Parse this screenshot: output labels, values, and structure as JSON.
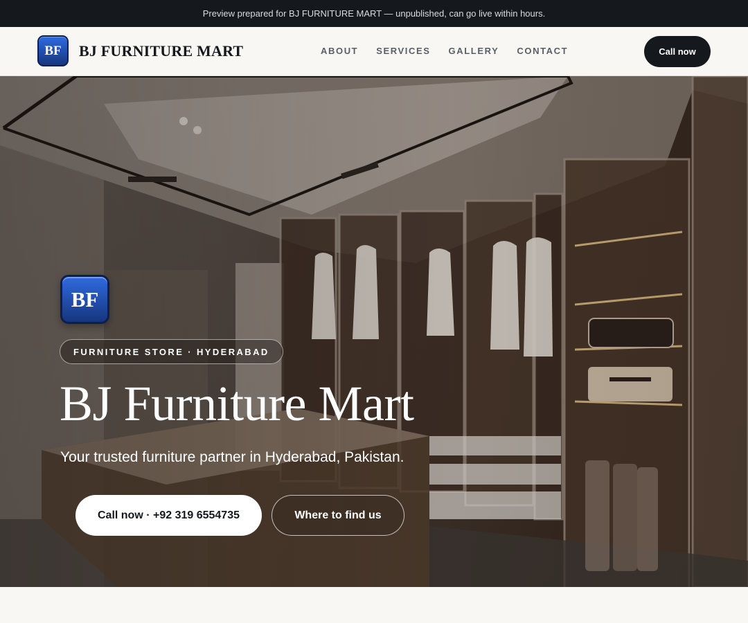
{
  "preview_banner": "Preview prepared for BJ FURNITURE MART — unpublished, can go live within hours.",
  "header": {
    "logo_text": "BF",
    "brand_name": "BJ FURNITURE MART",
    "nav": [
      "ABOUT",
      "SERVICES",
      "GALLERY",
      "CONTACT"
    ],
    "call_button": "Call now"
  },
  "hero": {
    "logo_text": "BF",
    "tag": "FURNITURE STORE · HYDERABAD",
    "title": "BJ Furniture Mart",
    "subtitle": "Your trusted furniture partner in Hyderabad, Pakistan.",
    "primary_button": "Call now · +92 319 6554735",
    "secondary_button": "Where to find us"
  },
  "colors": {
    "dark": "#15181d",
    "logo_blue": "#2f6be0",
    "page_bg": "#f8f7f4"
  }
}
